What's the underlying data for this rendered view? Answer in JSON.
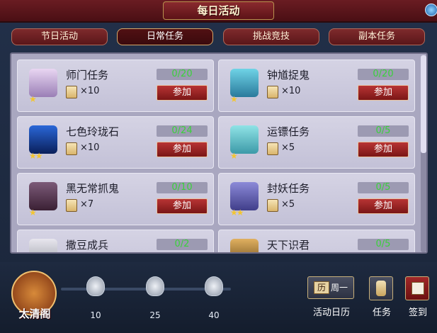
{
  "window": {
    "title": "每日活动"
  },
  "tabs": [
    {
      "label": "节日活动",
      "active": false
    },
    {
      "label": "日常任务",
      "active": true
    },
    {
      "label": "挑战竞技",
      "active": false
    },
    {
      "label": "副本任务",
      "active": false
    }
  ],
  "activities": [
    {
      "name": "师门任务",
      "progress": "0/20",
      "reward": "×10",
      "stars": 1,
      "icon": "scroll-icon",
      "join": "参加"
    },
    {
      "name": "钟馗捉鬼",
      "progress": "0/20",
      "reward": "×10",
      "stars": 1,
      "icon": "ghost-scroll-icon",
      "join": "参加"
    },
    {
      "name": "七色玲珑石",
      "progress": "0/24",
      "reward": "×10",
      "stars": 2,
      "icon": "toucan-icon",
      "join": "参加"
    },
    {
      "name": "运镖任务",
      "progress": "0/5",
      "reward": "×5",
      "stars": 1,
      "icon": "escort-book-icon",
      "join": "参加"
    },
    {
      "name": "黑无常抓鬼",
      "progress": "0/10",
      "reward": "×7",
      "stars": 1,
      "icon": "dark-scroll-icon",
      "join": "参加"
    },
    {
      "name": "封妖任务",
      "progress": "0/5",
      "reward": "×5",
      "stars": 2,
      "icon": "demon-book-icon",
      "join": "参加"
    },
    {
      "name": "撒豆成兵",
      "progress": "0/2",
      "reward": "",
      "stars": 0,
      "icon": "bean-icon",
      "join": ""
    },
    {
      "name": "天下识君",
      "progress": "0/5",
      "reward": "",
      "stars": 0,
      "icon": "bowl-icon",
      "join": ""
    }
  ],
  "bottom": {
    "badge_label": "太清阁",
    "milestones": [
      "10",
      "25",
      "40"
    ],
    "calendar_label": "活动日历",
    "calendar_badge": "历",
    "calendar_day": "周一",
    "task_label": "任务",
    "signin_label": "签到"
  },
  "colors": {
    "progress_text": "#3bd13b",
    "join_button": "#9a2222",
    "panel": "#a9a7c0"
  }
}
